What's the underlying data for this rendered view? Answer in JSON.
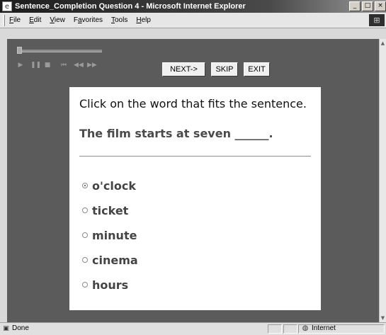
{
  "window": {
    "title": "Sentence_Completion Question 4 - Microsoft Internet Explorer",
    "icons": {
      "app": "ie-page-icon",
      "minimize": "minimize-icon",
      "maximize": "maximize-icon",
      "close": "close-icon"
    },
    "controls": {
      "minimize": "_",
      "maximize": "□",
      "close": "×"
    }
  },
  "menubar": {
    "items": [
      {
        "label": "File",
        "mnemonic": "F"
      },
      {
        "label": "Edit",
        "mnemonic": "E"
      },
      {
        "label": "View",
        "mnemonic": "V"
      },
      {
        "label": "Favorites",
        "mnemonic": "a"
      },
      {
        "label": "Tools",
        "mnemonic": "T"
      },
      {
        "label": "Help",
        "mnemonic": "H"
      }
    ],
    "logo_icon": "windows-logo-icon"
  },
  "player": {
    "progress": 0,
    "buttons": [
      "play-icon",
      "pause-icon",
      "stop-icon",
      "skip-back-icon",
      "rewind-icon",
      "fast-forward-icon"
    ]
  },
  "nav": {
    "next_label": "NEXT->",
    "skip_label": "SKIP",
    "exit_label": "EXIT"
  },
  "question": {
    "instruction": "Click on the word that fits the sentence.",
    "sentence": "The film starts at seven ______.",
    "options": [
      {
        "label": "o'clock",
        "selected": true
      },
      {
        "label": "ticket",
        "selected": false
      },
      {
        "label": "minute",
        "selected": false
      },
      {
        "label": "cinema",
        "selected": false
      },
      {
        "label": "hours",
        "selected": false
      }
    ]
  },
  "statusbar": {
    "status": "Done",
    "zone": "Internet",
    "status_icon": "page-done-icon",
    "zone_icon": "globe-icon"
  },
  "colors": {
    "content_bg": "#5b5b5b",
    "card_bg": "#ffffff",
    "sentence_text": "#4a4a4a"
  }
}
